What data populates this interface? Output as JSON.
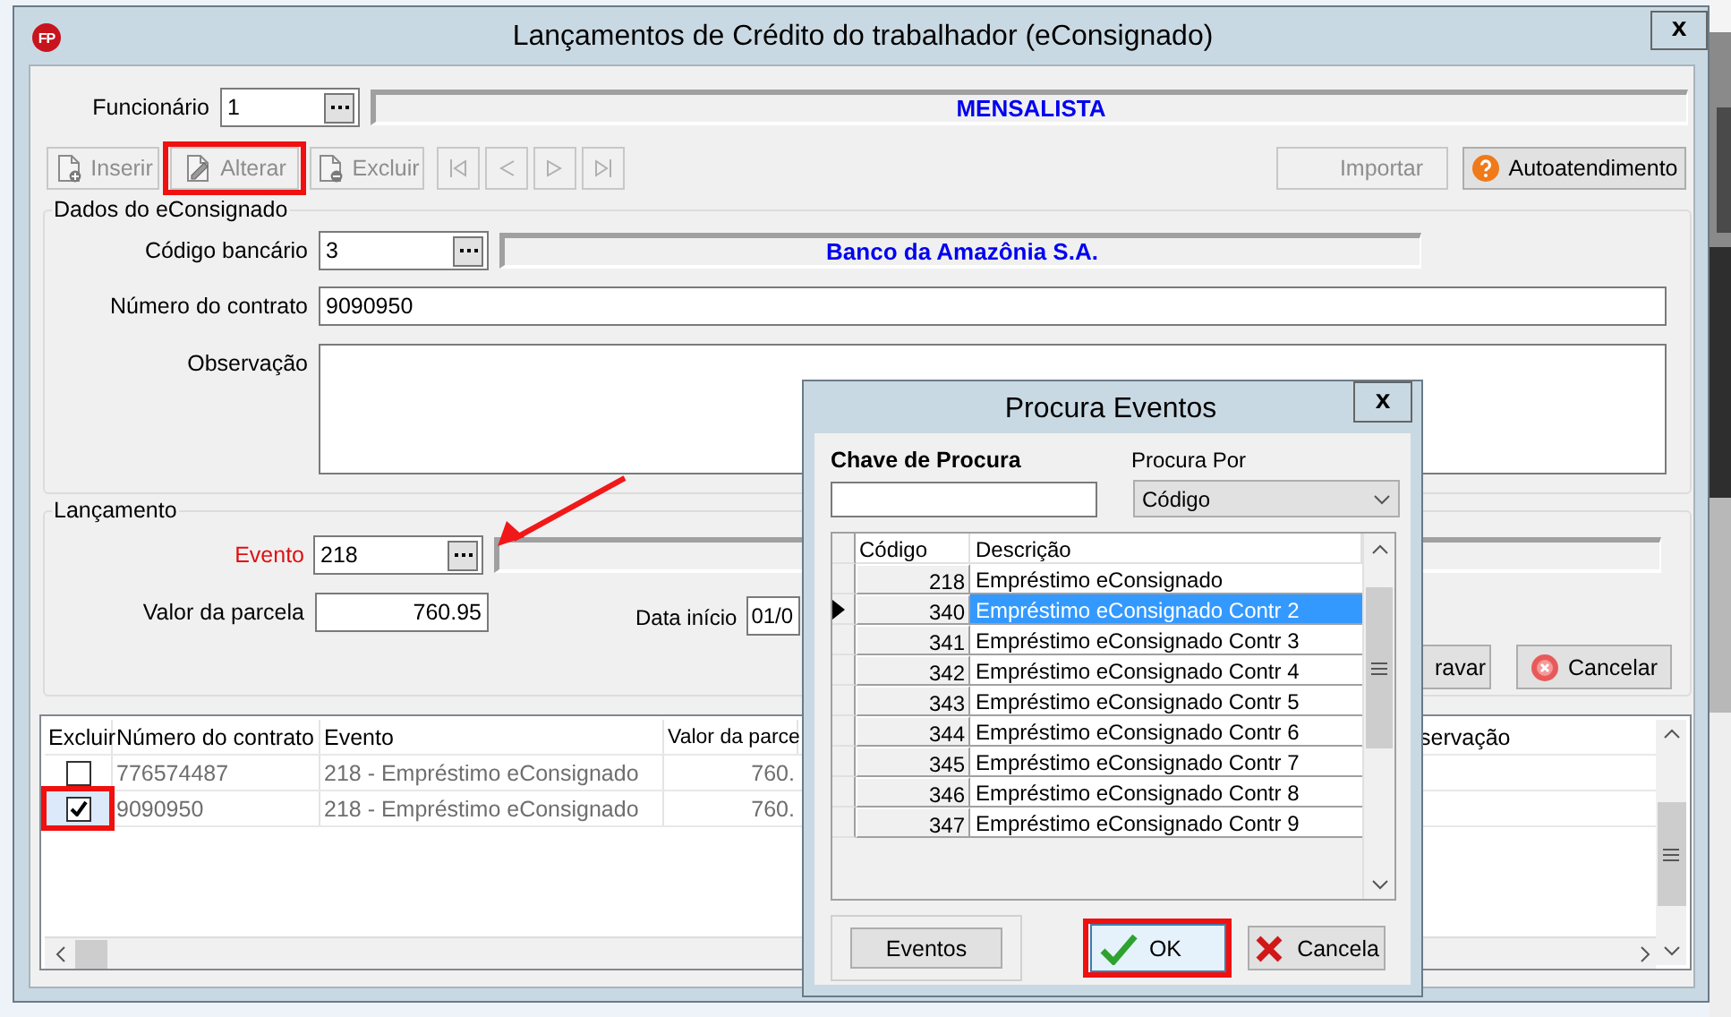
{
  "window": {
    "logo": "FP",
    "title": "Lançamentos de Crédito do trabalhador (eConsignado)",
    "close": "x"
  },
  "employee": {
    "label": "Funcionário",
    "value": "1",
    "name": "MENSALISTA"
  },
  "toolbar": {
    "buttons": [
      {
        "kind": "insert",
        "label": "Inserir",
        "disabled": true,
        "highlighted": false
      },
      {
        "kind": "edit",
        "label": "Alterar",
        "disabled": true,
        "highlighted": true
      },
      {
        "kind": "delete",
        "label": "Excluir",
        "disabled": true,
        "highlighted": false
      }
    ],
    "nav": [
      {
        "kind": "first",
        "disabled": true
      },
      {
        "kind": "prev",
        "disabled": true
      },
      {
        "kind": "next",
        "disabled": true
      },
      {
        "kind": "last",
        "disabled": true
      }
    ],
    "actions": [
      {
        "kind": "import",
        "label": "Importar",
        "disabled": true
      },
      {
        "kind": "help",
        "label": "Autoatendimento",
        "disabled": false
      }
    ]
  },
  "dados": {
    "title": "Dados do eConsignado",
    "bank": {
      "label": "Código bancário",
      "value": "3",
      "name": "Banco da Amazônia S.A."
    },
    "contract": {
      "label": "Número do contrato",
      "value": "9090950"
    },
    "notes": {
      "label": "Observação"
    }
  },
  "lancamento": {
    "title": "Lançamento",
    "event": {
      "label": "Evento",
      "value": "218",
      "required": true,
      "pointed": true
    },
    "amount": {
      "label": "Valor da parcela",
      "value": "760.95"
    },
    "start": {
      "label": "Data início",
      "value": "01/0"
    },
    "buttons": [
      {
        "kind": "save",
        "label": "ravar"
      },
      {
        "kind": "cancel",
        "label": "Cancelar"
      }
    ]
  },
  "grid": {
    "columns": [
      "Excluir",
      "Número do contrato",
      "Evento",
      "Valor da parce",
      "servação"
    ],
    "rows": [
      {
        "checked": false,
        "highlighted": false,
        "selected": false,
        "contract": "776574487",
        "event": "218 - Empréstimo eConsignado",
        "amount": "760."
      },
      {
        "checked": true,
        "highlighted": true,
        "selected": true,
        "contract": "9090950",
        "event": "218 - Empréstimo eConsignado",
        "amount": "760."
      }
    ]
  },
  "dialog": {
    "title": "Procura Eventos",
    "close": "x",
    "search_label": "Chave de Procura",
    "search_by_label": "Procura Por",
    "search_by": "Código",
    "columns": [
      "Código",
      "Descrição"
    ],
    "rows": [
      {
        "code": "218",
        "description": "Empréstimo eConsignado",
        "selected": false
      },
      {
        "code": "340",
        "description": "Empréstimo eConsignado Contr 2",
        "selected": true
      },
      {
        "code": "341",
        "description": "Empréstimo eConsignado Contr 3",
        "selected": false
      },
      {
        "code": "342",
        "description": "Empréstimo eConsignado Contr 4",
        "selected": false
      },
      {
        "code": "343",
        "description": "Empréstimo eConsignado Contr 5",
        "selected": false
      },
      {
        "code": "344",
        "description": "Empréstimo eConsignado Contr 6",
        "selected": false
      },
      {
        "code": "345",
        "description": "Empréstimo eConsignado Contr 7",
        "selected": false
      },
      {
        "code": "346",
        "description": "Empréstimo eConsignado Contr 8",
        "selected": false
      },
      {
        "code": "347",
        "description": "Empréstimo eConsignado Contr 9",
        "selected": false
      }
    ],
    "buttons": [
      {
        "kind": "plain",
        "label": "Eventos"
      },
      {
        "kind": "ok",
        "label": "OK",
        "highlighted": true
      },
      {
        "kind": "cancel",
        "label": "Cancela",
        "highlighted": false
      }
    ]
  }
}
